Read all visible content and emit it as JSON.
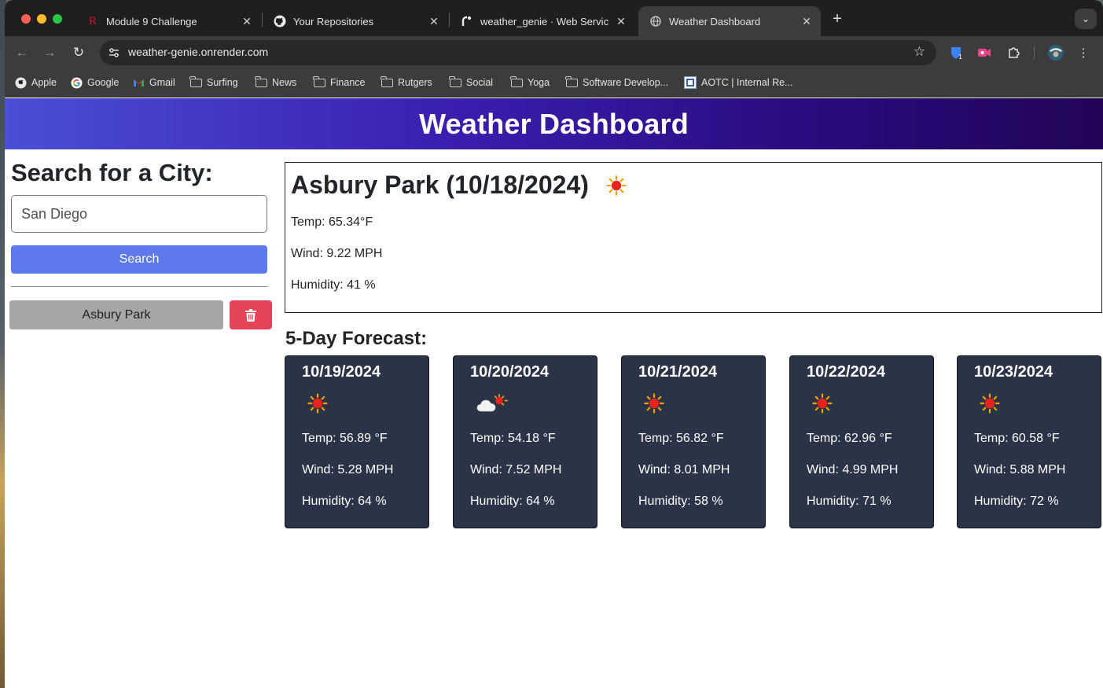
{
  "browser": {
    "tabs": [
      {
        "title": "Module 9 Challenge",
        "favicon": "rutgers-r-icon",
        "active": false
      },
      {
        "title": "Your Repositories",
        "favicon": "github-icon",
        "active": false
      },
      {
        "title": "weather_genie · Web Servic",
        "favicon": "render-icon",
        "active": false
      },
      {
        "title": "Weather Dashboard",
        "favicon": "globe-icon",
        "active": true
      }
    ],
    "url": "weather-genie.onrender.com",
    "bookmarks": [
      {
        "label": "Apple",
        "icon": "apple-icon"
      },
      {
        "label": "Google",
        "icon": "google-icon"
      },
      {
        "label": "Gmail",
        "icon": "gmail-icon"
      },
      {
        "label": "Surfing",
        "icon": "folder-icon"
      },
      {
        "label": "News",
        "icon": "folder-icon"
      },
      {
        "label": "Finance",
        "icon": "folder-icon"
      },
      {
        "label": "Rutgers",
        "icon": "folder-icon"
      },
      {
        "label": "Social",
        "icon": "folder-icon"
      },
      {
        "label": "Yoga",
        "icon": "folder-icon"
      },
      {
        "label": "Software Develop...",
        "icon": "folder-icon"
      },
      {
        "label": "AOTC | Internal Re...",
        "icon": "site-icon"
      }
    ]
  },
  "header": {
    "title": "Weather Dashboard"
  },
  "search": {
    "heading": "Search for a City:",
    "input_value": "San Diego",
    "button_label": "Search"
  },
  "history": [
    {
      "city": "Asbury Park"
    }
  ],
  "current": {
    "title": "Asbury Park (10/18/2024)",
    "icon": "sun-icon",
    "temp": "Temp: 65.34°F",
    "wind": "Wind: 9.22 MPH",
    "humidity": "Humidity: 41 %"
  },
  "forecast": {
    "heading": "5-Day Forecast:",
    "days": [
      {
        "date": "10/19/2024",
        "icon": "sun-icon",
        "temp": "Temp: 56.89 °F",
        "wind": "Wind: 5.28 MPH",
        "humidity": "Humidity: 64 %"
      },
      {
        "date": "10/20/2024",
        "icon": "partly-cloudy-icon",
        "temp": "Temp: 54.18 °F",
        "wind": "Wind: 7.52 MPH",
        "humidity": "Humidity: 64 %"
      },
      {
        "date": "10/21/2024",
        "icon": "sun-icon",
        "temp": "Temp: 56.82 °F",
        "wind": "Wind: 8.01 MPH",
        "humidity": "Humidity: 58 %"
      },
      {
        "date": "10/22/2024",
        "icon": "sun-icon",
        "temp": "Temp: 62.96 °F",
        "wind": "Wind: 4.99 MPH",
        "humidity": "Humidity: 71 %"
      },
      {
        "date": "10/23/2024",
        "icon": "sun-icon",
        "temp": "Temp: 60.58 °F",
        "wind": "Wind: 5.88 MPH",
        "humidity": "Humidity: 72 %"
      }
    ]
  },
  "colors": {
    "banner_start": "#4a4fd6",
    "banner_end": "#220558",
    "search_button": "#5e7aea",
    "delete_button": "#e54458",
    "history_button": "#a6a6a6",
    "forecast_card": "#2b3346"
  }
}
